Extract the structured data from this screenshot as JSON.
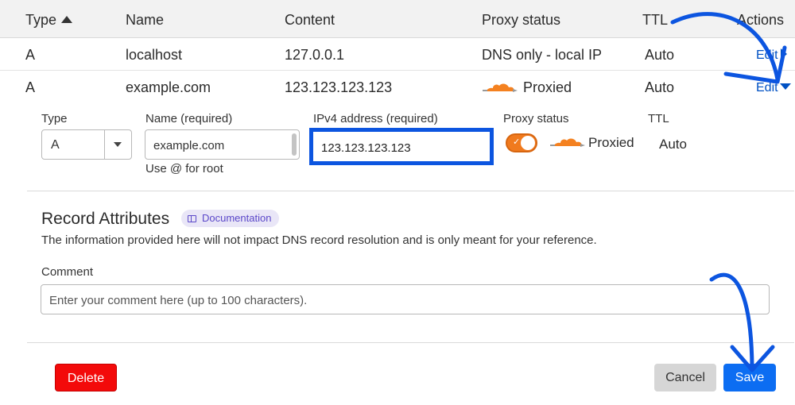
{
  "table": {
    "headers": {
      "type": "Type",
      "name": "Name",
      "content": "Content",
      "proxy_status": "Proxy status",
      "ttl": "TTL",
      "actions": "Actions"
    },
    "rows": [
      {
        "type": "A",
        "name": "localhost",
        "content": "127.0.0.1",
        "proxy_status": "DNS only - local IP",
        "ttl": "Auto",
        "action": "Edit"
      },
      {
        "type": "A",
        "name": "example.com",
        "content": "123.123.123.123",
        "proxy_status": "Proxied",
        "ttl": "Auto",
        "action": "Edit"
      }
    ]
  },
  "edit_form": {
    "type_label": "Type",
    "type_value": "A",
    "name_label": "Name (required)",
    "name_value": "example.com",
    "name_hint": "Use @ for root",
    "ipv4_label": "IPv4 address (required)",
    "ipv4_value": "123.123.123.123",
    "proxy_label": "Proxy status",
    "proxy_toggle_on": true,
    "proxy_value": "Proxied",
    "ttl_label": "TTL",
    "ttl_value": "Auto"
  },
  "attributes": {
    "title": "Record Attributes",
    "doc_label": "Documentation",
    "description": "The information provided here will not impact DNS record resolution and is only meant for your reference.",
    "comment_label": "Comment",
    "comment_placeholder": "Enter your comment here (up to 100 characters)."
  },
  "actions": {
    "delete": "Delete",
    "cancel": "Cancel",
    "save": "Save"
  },
  "colors": {
    "accent": "#0c6df2",
    "link": "#0051c3",
    "danger": "#f30a0a",
    "cloud": "#f48120",
    "annotation": "#0c55e0"
  },
  "icons": {
    "sort": "sort-ascending-icon",
    "cloud": "orange-cloud-proxied-icon",
    "edit_expand": "triangle-right-icon",
    "edit_collapse": "triangle-down-icon",
    "select_arrow": "chevron-down-icon",
    "doc": "book-icon",
    "annotation": "curved-arrow-icon"
  }
}
